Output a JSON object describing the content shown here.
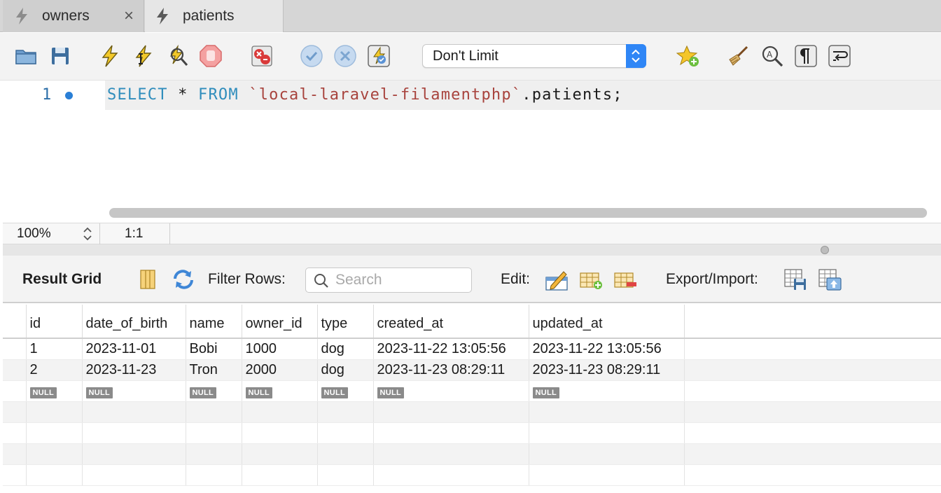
{
  "tabs": [
    {
      "label": "owners",
      "active": false,
      "closable": true
    },
    {
      "label": "patients",
      "active": true,
      "closable": false
    }
  ],
  "toolbar": {
    "limit_select_value": "Don't Limit",
    "icons": [
      "open-folder-icon",
      "save-icon",
      "execute-icon",
      "execute-current-icon",
      "explain-icon",
      "stop-icon",
      "toggle-error-icon",
      "commit-icon",
      "rollback-icon",
      "autocommit-icon",
      "add-snippet-icon",
      "beautify-icon",
      "find-icon",
      "invisible-chars-icon",
      "wrap-lines-icon"
    ]
  },
  "editor": {
    "line_number": "1",
    "sql_keyword_1": "SELECT",
    "sql_star": " * ",
    "sql_keyword_2": "FROM",
    "sql_space": " ",
    "sql_schema": "`local-laravel-filamentphp`",
    "sql_rest": ".patients;"
  },
  "status": {
    "zoom": "100%",
    "cursor_position": "1:1"
  },
  "result_toolbar": {
    "title": "Result Grid",
    "filter_label": "Filter Rows:",
    "search_placeholder": "Search",
    "edit_label": "Edit:",
    "export_label": "Export/Import:"
  },
  "grid": {
    "columns": [
      "id",
      "date_of_birth",
      "name",
      "owner_id",
      "type",
      "created_at",
      "updated_at"
    ],
    "rows": [
      [
        "1",
        "2023-11-01",
        "Bobi",
        "1000",
        "dog",
        "2023-11-22 13:05:56",
        "2023-11-22 13:05:56"
      ],
      [
        "2",
        "2023-11-23",
        "Tron",
        "2000",
        "dog",
        "2023-11-23 08:29:11",
        "2023-11-23 08:29:11"
      ]
    ],
    "null_label": "NULL"
  },
  "colors": {
    "keyword": "#2f8dbc",
    "string": "#a8433d",
    "accent": "#2f86f6"
  }
}
